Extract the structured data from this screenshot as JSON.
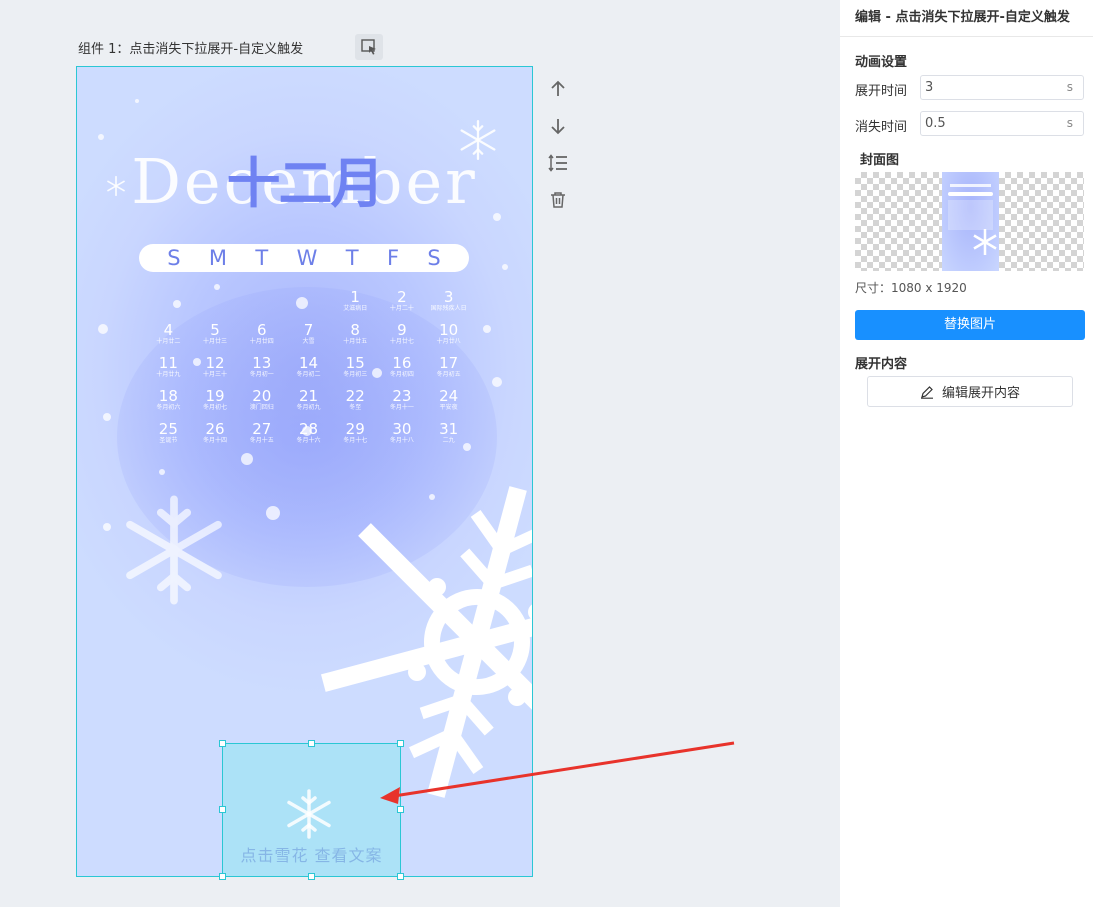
{
  "component": {
    "title": "组件 1：点击消失下拉展开-自定义触发"
  },
  "wallpaper": {
    "month_en": "December",
    "month_cn": "十二月",
    "weekdays": [
      "S",
      "M",
      "T",
      "W",
      "T",
      "F",
      "S"
    ],
    "days": [
      {
        "d": "",
        "l": ""
      },
      {
        "d": "",
        "l": ""
      },
      {
        "d": "",
        "l": ""
      },
      {
        "d": "",
        "l": ""
      },
      {
        "d": "1",
        "l": "艾滋病日"
      },
      {
        "d": "2",
        "l": "十月二十"
      },
      {
        "d": "3",
        "l": "国际残疾人日"
      },
      {
        "d": "4",
        "l": "十月廿二"
      },
      {
        "d": "5",
        "l": "十月廿三"
      },
      {
        "d": "6",
        "l": "十月廿四"
      },
      {
        "d": "7",
        "l": "大雪"
      },
      {
        "d": "8",
        "l": "十月廿五"
      },
      {
        "d": "9",
        "l": "十月廿七"
      },
      {
        "d": "10",
        "l": "十月廿八"
      },
      {
        "d": "11",
        "l": "十月廿九"
      },
      {
        "d": "12",
        "l": "十月三十"
      },
      {
        "d": "13",
        "l": "冬月初一"
      },
      {
        "d": "14",
        "l": "冬月初二"
      },
      {
        "d": "15",
        "l": "冬月初三"
      },
      {
        "d": "16",
        "l": "冬月初四"
      },
      {
        "d": "17",
        "l": "冬月初五"
      },
      {
        "d": "18",
        "l": "冬月初六"
      },
      {
        "d": "19",
        "l": "冬月初七"
      },
      {
        "d": "20",
        "l": "澳门回归"
      },
      {
        "d": "21",
        "l": "冬月初九"
      },
      {
        "d": "22",
        "l": "冬至"
      },
      {
        "d": "23",
        "l": "冬月十一"
      },
      {
        "d": "24",
        "l": "平安夜"
      },
      {
        "d": "25",
        "l": "圣诞节"
      },
      {
        "d": "26",
        "l": "冬月十四"
      },
      {
        "d": "27",
        "l": "冬月十五"
      },
      {
        "d": "28",
        "l": "冬月十六"
      },
      {
        "d": "29",
        "l": "冬月十七"
      },
      {
        "d": "30",
        "l": "冬月十八"
      },
      {
        "d": "31",
        "l": "二九"
      }
    ]
  },
  "tap_area": {
    "text": "点击雪花 查看文案"
  },
  "side_tools": {
    "icons": [
      "arrow-up-icon",
      "arrow-down-icon",
      "line-height-icon",
      "trash-icon"
    ]
  },
  "panel": {
    "header": "编辑 - 点击消失下拉展开-自定义触发",
    "animation_section": "动画设置",
    "expand_time_label": "展开时间",
    "expand_time_value": "3",
    "vanish_time_label": "消失时间",
    "vanish_time_value": "0.5",
    "unit": "s",
    "cover_section": "封面图",
    "size_text": "尺寸：1080 x 1920",
    "replace_button": "替换图片",
    "content_section": "展开内容",
    "edit_content_button": "编辑展开内容"
  },
  "colors": {
    "accent": "#1890ff",
    "selection": "#2bc7d4",
    "arrow": "#e8332b"
  }
}
